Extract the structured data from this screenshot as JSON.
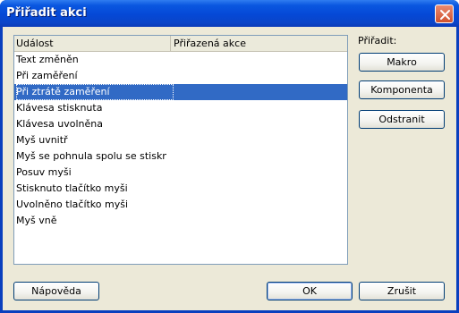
{
  "window": {
    "title": "Přiřadit akci"
  },
  "list": {
    "columns": [
      "Událost",
      "Přiřazená akce"
    ],
    "rows": [
      "Text změněn",
      "Při zaměření",
      "Při ztrátě zaměření",
      "Klávesa stisknuta",
      "Klávesa uvolněna",
      "Myš uvnitř",
      "Myš se pohnula spolu se stisknutou",
      "Posuv myši",
      "Stisknuto tlačítko myši",
      "Uvolněno tlačítko myši",
      "Myš vně"
    ],
    "selected_index": 2
  },
  "assign": {
    "label": "Přiřadit:",
    "macro_button": "Makro",
    "component_button": "Komponenta",
    "remove_button": "Odstranit"
  },
  "footer": {
    "help_button": "Nápověda",
    "ok_button": "OK",
    "cancel_button": "Zrušit"
  },
  "colors": {
    "titlebar": "#0548d6",
    "selection": "#316ac5",
    "close_button": "#d0512e",
    "dialog_background": "#ece9d8"
  },
  "icons": {
    "close": "close-icon"
  }
}
